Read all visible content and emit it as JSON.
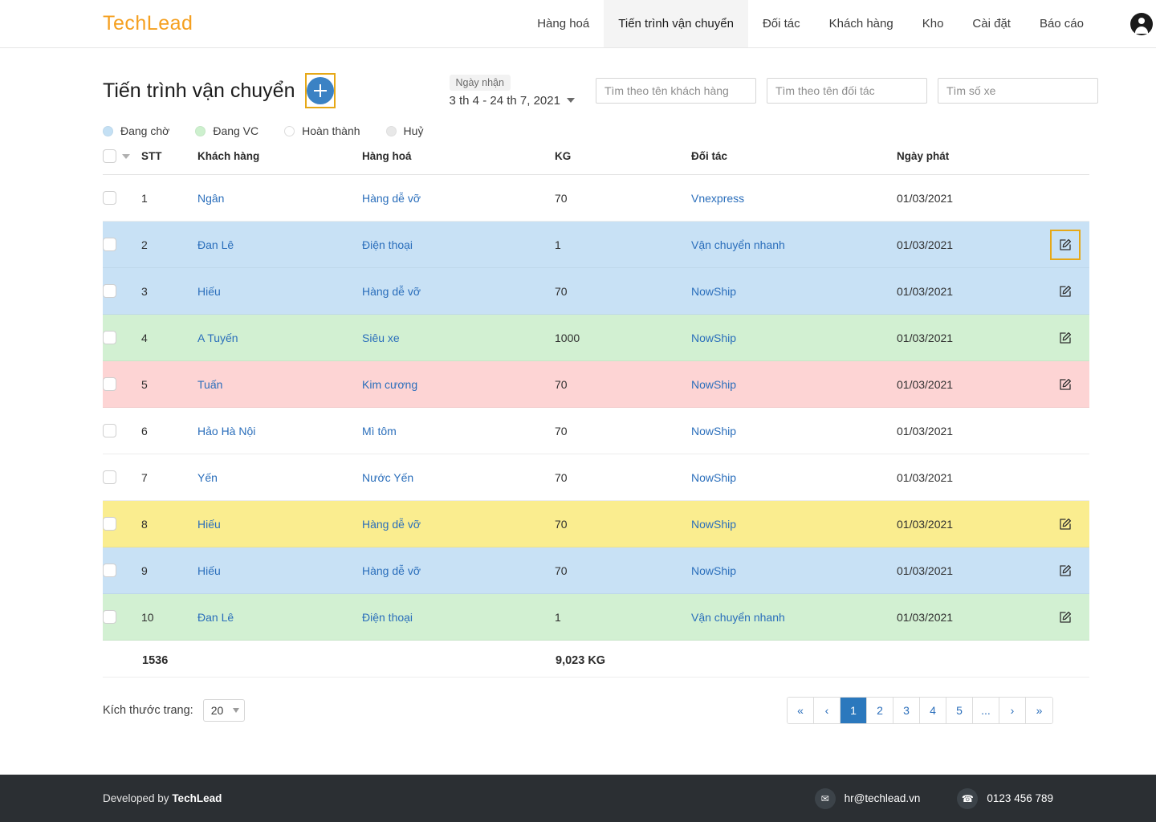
{
  "brand": {
    "name": "TechLead"
  },
  "nav": {
    "items": [
      {
        "label": "Hàng hoá",
        "active": false
      },
      {
        "label": "Tiến trình vận chuyển",
        "active": true
      },
      {
        "label": "Đối tác",
        "active": false
      },
      {
        "label": "Khách hàng",
        "active": false
      },
      {
        "label": "Kho",
        "active": false
      },
      {
        "label": "Cài đặt",
        "active": false
      },
      {
        "label": "Báo cáo",
        "active": false
      }
    ],
    "avatar_icon": "user-avatar-icon"
  },
  "header": {
    "title": "Tiến trình vận chuyển",
    "add_button_icon": "plus-icon"
  },
  "date_filter": {
    "chip_label": "Ngày nhận",
    "value": "3 th 4  -  24 th 7, 2021",
    "caret_icon": "chevron-down-icon"
  },
  "search": {
    "customer_placeholder": "Tìm theo tên khách hàng",
    "partner_placeholder": "Tìm theo tên đối tác",
    "vehicle_placeholder": "Tìm số xe",
    "customer_value": "",
    "partner_value": "",
    "vehicle_value": ""
  },
  "legend": [
    {
      "label": "Đang chờ",
      "color": "#c4e0f4"
    },
    {
      "label": "Đang VC",
      "color": "#cdf0ce"
    },
    {
      "label": "Hoàn thành",
      "color": "#ffffff"
    },
    {
      "label": "Huỷ",
      "color": "#e8e8e8"
    }
  ],
  "table": {
    "columns": [
      {
        "key": "check",
        "label": ""
      },
      {
        "key": "stt",
        "label": "STT"
      },
      {
        "key": "customer",
        "label": "Khách hàng"
      },
      {
        "key": "goods",
        "label": "Hàng hoá"
      },
      {
        "key": "kg",
        "label": "KG"
      },
      {
        "key": "partner",
        "label": "Đối tác"
      },
      {
        "key": "date",
        "label": "Ngày phát"
      },
      {
        "key": "action",
        "label": ""
      }
    ],
    "rows": [
      {
        "stt": "1",
        "customer": "Ngân",
        "goods": "Hàng dễ vỡ",
        "kg": "70",
        "partner": "Vnexpress",
        "date": "01/03/2021",
        "status_color": "#ffffff",
        "has_edit": false,
        "edit_focused": false
      },
      {
        "stt": "2",
        "customer": "Đan Lê",
        "goods": "Điện thoại",
        "kg": "1",
        "partner": "Vận chuyển nhanh",
        "date": "01/03/2021",
        "status_color": "#c8e1f5",
        "has_edit": true,
        "edit_focused": true
      },
      {
        "stt": "3",
        "customer": "Hiếu",
        "goods": "Hàng dễ vỡ",
        "kg": "70",
        "partner": "NowShip",
        "date": "01/03/2021",
        "status_color": "#c8e1f5",
        "has_edit": true,
        "edit_focused": false
      },
      {
        "stt": "4",
        "customer": "A Tuyến",
        "goods": "Siêu xe",
        "kg": "1000",
        "partner": "NowShip",
        "date": "01/03/2021",
        "status_color": "#d2f0d2",
        "has_edit": true,
        "edit_focused": false
      },
      {
        "stt": "5",
        "customer": "Tuấn",
        "goods": "Kim cương",
        "kg": "70",
        "partner": "NowShip",
        "date": "01/03/2021",
        "status_color": "#fdd4d4",
        "has_edit": true,
        "edit_focused": false
      },
      {
        "stt": "6",
        "customer": "Hảo Hà Nội",
        "goods": "Mì tôm",
        "kg": "70",
        "partner": "NowShip",
        "date": "01/03/2021",
        "status_color": "#ffffff",
        "has_edit": false,
        "edit_focused": false
      },
      {
        "stt": "7",
        "customer": "Yến",
        "goods": "Nước Yến",
        "kg": "70",
        "partner": "NowShip",
        "date": "01/03/2021",
        "status_color": "#ffffff",
        "has_edit": false,
        "edit_focused": false
      },
      {
        "stt": "8",
        "customer": "Hiếu",
        "goods": "Hàng dễ vỡ",
        "kg": "70",
        "partner": "NowShip",
        "date": "01/03/2021",
        "status_color": "#faed8f",
        "has_edit": true,
        "edit_focused": false
      },
      {
        "stt": "9",
        "customer": "Hiếu",
        "goods": "Hàng dễ vỡ",
        "kg": "70",
        "partner": "NowShip",
        "date": "01/03/2021",
        "status_color": "#c8e1f5",
        "has_edit": true,
        "edit_focused": false
      },
      {
        "stt": "10",
        "customer": "Đan Lê",
        "goods": "Điện thoại",
        "kg": "1",
        "partner": "Vận chuyển nhanh",
        "date": "01/03/2021",
        "status_color": "#d2f0d2",
        "has_edit": true,
        "edit_focused": false
      }
    ],
    "totals": {
      "count": "1536",
      "weight": "9,023 KG"
    }
  },
  "pagination": {
    "page_size_label": "Kích thước trang:",
    "page_size_value": "20",
    "buttons": [
      {
        "label": "«",
        "active": false
      },
      {
        "label": "‹",
        "active": false
      },
      {
        "label": "1",
        "active": true
      },
      {
        "label": "2",
        "active": false
      },
      {
        "label": "3",
        "active": false
      },
      {
        "label": "4",
        "active": false
      },
      {
        "label": "5",
        "active": false
      },
      {
        "label": "...",
        "active": false
      },
      {
        "label": "›",
        "active": false
      },
      {
        "label": "»",
        "active": false
      }
    ]
  },
  "footer": {
    "developed_prefix": "Developed by ",
    "developed_brand": "TechLead",
    "email": "hr@techlead.vn",
    "phone": "0123 456 789",
    "email_icon": "mail-icon",
    "phone_icon": "phone-icon"
  },
  "colors": {
    "brand_orange": "#f5a020",
    "accent_blue": "#2b78bd",
    "link_blue": "#2a6ebb",
    "focus_gold": "#e6a817",
    "footer_dark": "#2b2f33"
  }
}
